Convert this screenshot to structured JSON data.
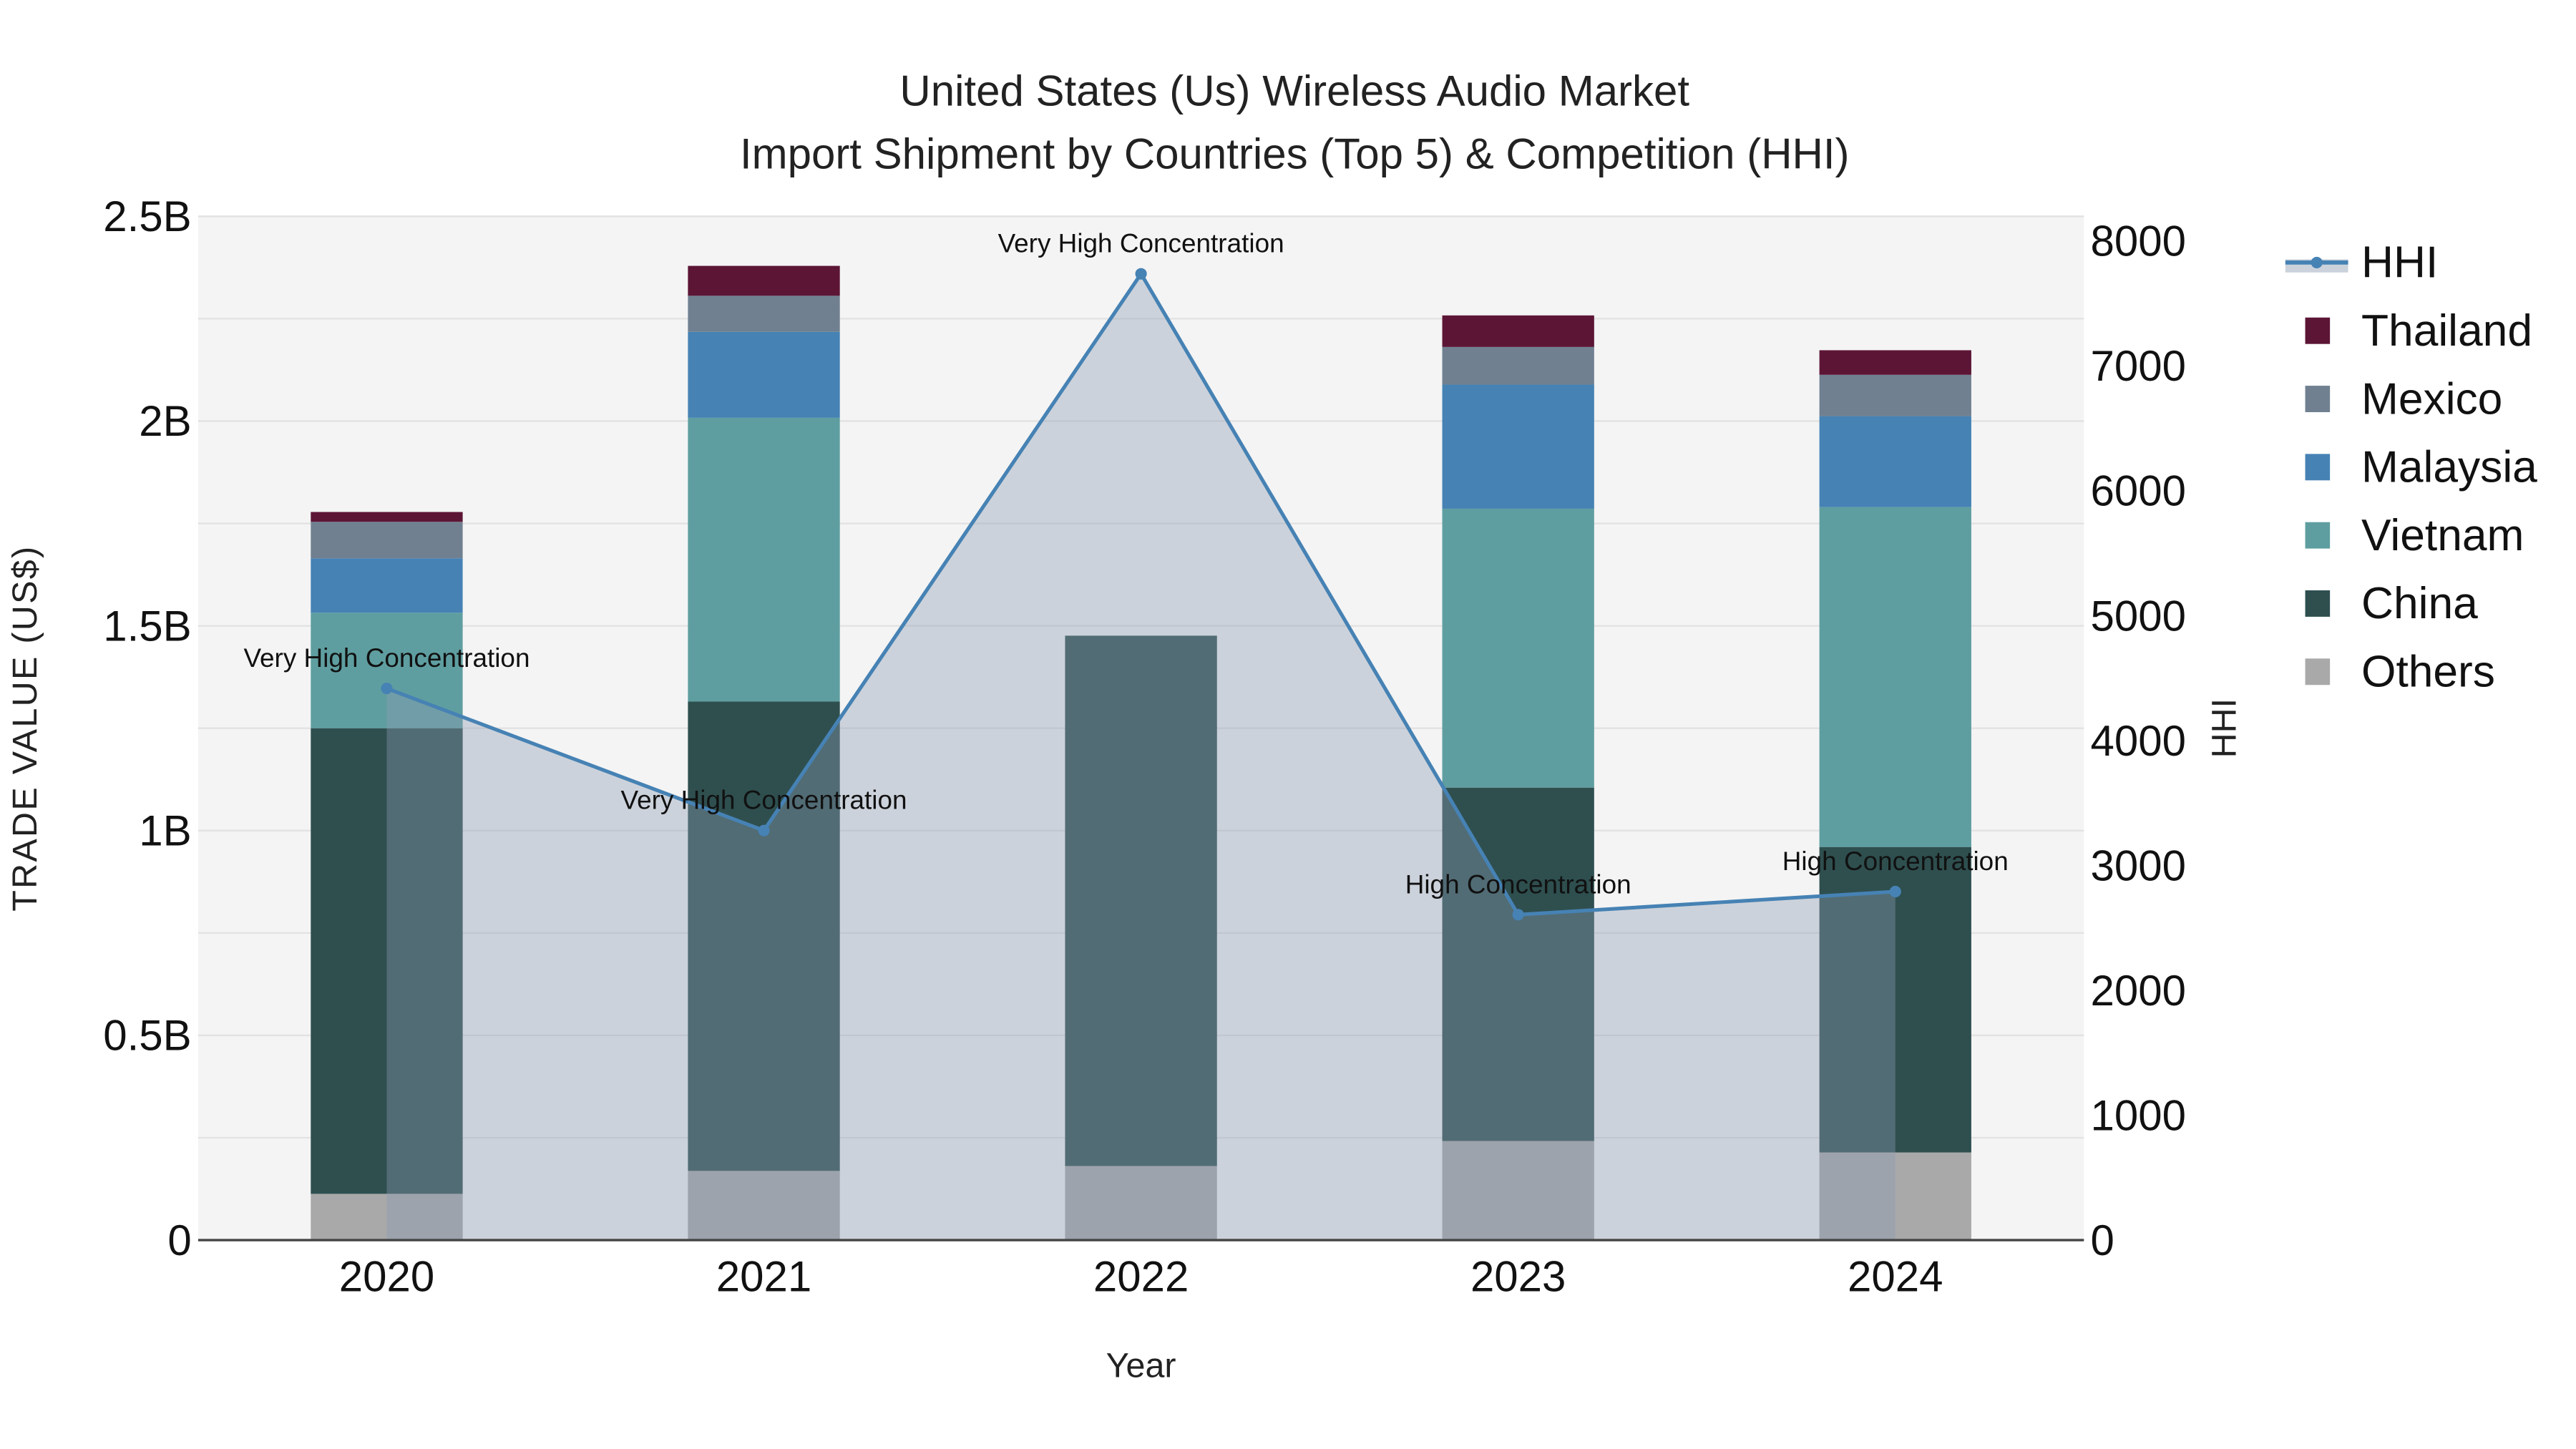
{
  "chart_data": {
    "type": "bar",
    "title": "United States (Us) Wireless Audio Market",
    "subtitle": "Import Shipment by Countries (Top 5) & Competition (HHI)",
    "xlabel": "Year",
    "ylabel": "TRADE VALUE (US$)",
    "y2label": "HHI",
    "categories": [
      "2020",
      "2021",
      "2022",
      "2023",
      "2024"
    ],
    "ylim": [
      0,
      2.5
    ],
    "yunit": "B",
    "yticks": [
      "0",
      "0.5B",
      "1B",
      "1.5B",
      "2B",
      "2.5B"
    ],
    "y2lim": [
      0,
      8000
    ],
    "y2ticks": [
      "0",
      "1000",
      "2000",
      "3000",
      "4000",
      "5000",
      "6000",
      "7000",
      "8000"
    ],
    "grid": true,
    "legend_placement": "right",
    "series": [
      {
        "name": "Others",
        "color": "#a9a9a9",
        "values": [
          0.113,
          0.169,
          0.181,
          0.242,
          0.214
        ]
      },
      {
        "name": "China",
        "color": "#2f4f4f",
        "values": [
          1.137,
          1.146,
          1.295,
          0.863,
          0.746
        ]
      },
      {
        "name": "Vietnam",
        "color": "#5f9ea0",
        "values": [
          0.282,
          0.693,
          0,
          0.681,
          0.83
        ]
      },
      {
        "name": "Malaysia",
        "color": "#4682b4",
        "values": [
          0.133,
          0.21,
          0,
          0.303,
          0.222
        ]
      },
      {
        "name": "Mexico",
        "color": "#708090",
        "values": [
          0.089,
          0.088,
          0,
          0.092,
          0.101
        ]
      },
      {
        "name": "Thailand",
        "color": "#5c1535",
        "values": [
          0.024,
          0.073,
          0,
          0.077,
          0.06
        ]
      }
    ],
    "hhi": {
      "name": "HHI",
      "color": "#4682b4",
      "values": [
        4418,
        3280,
        7738,
        2606,
        2791
      ],
      "labels": [
        "Very High Concentration",
        "Very High Concentration",
        "Very High Concentration",
        "High Concentration",
        "High Concentration"
      ]
    },
    "legend": [
      "HHI",
      "Thailand",
      "Mexico",
      "Malaysia",
      "Vietnam",
      "China",
      "Others"
    ]
  }
}
